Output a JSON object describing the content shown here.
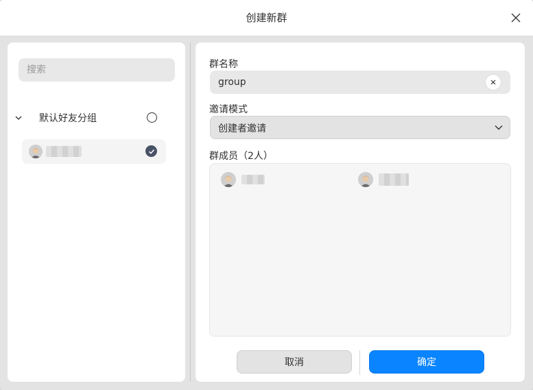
{
  "window": {
    "title": "创建新群",
    "close_icon": "close-icon"
  },
  "left": {
    "search": {
      "placeholder": "搜索",
      "value": ""
    },
    "group": {
      "label": "默认好友分组",
      "expanded": true,
      "selected": false
    },
    "friends": [
      {
        "name": "",
        "checked": true
      }
    ]
  },
  "right": {
    "name_label": "群名称",
    "name_value": "group",
    "invite_label": "邀请模式",
    "invite_value": "创建者邀请",
    "members_label": "群成员（2人）",
    "members": [
      {
        "name": ""
      },
      {
        "name": ""
      }
    ]
  },
  "buttons": {
    "cancel": "取消",
    "confirm": "确定"
  },
  "colors": {
    "accent": "#0a84ff",
    "check": "#4a5365"
  }
}
